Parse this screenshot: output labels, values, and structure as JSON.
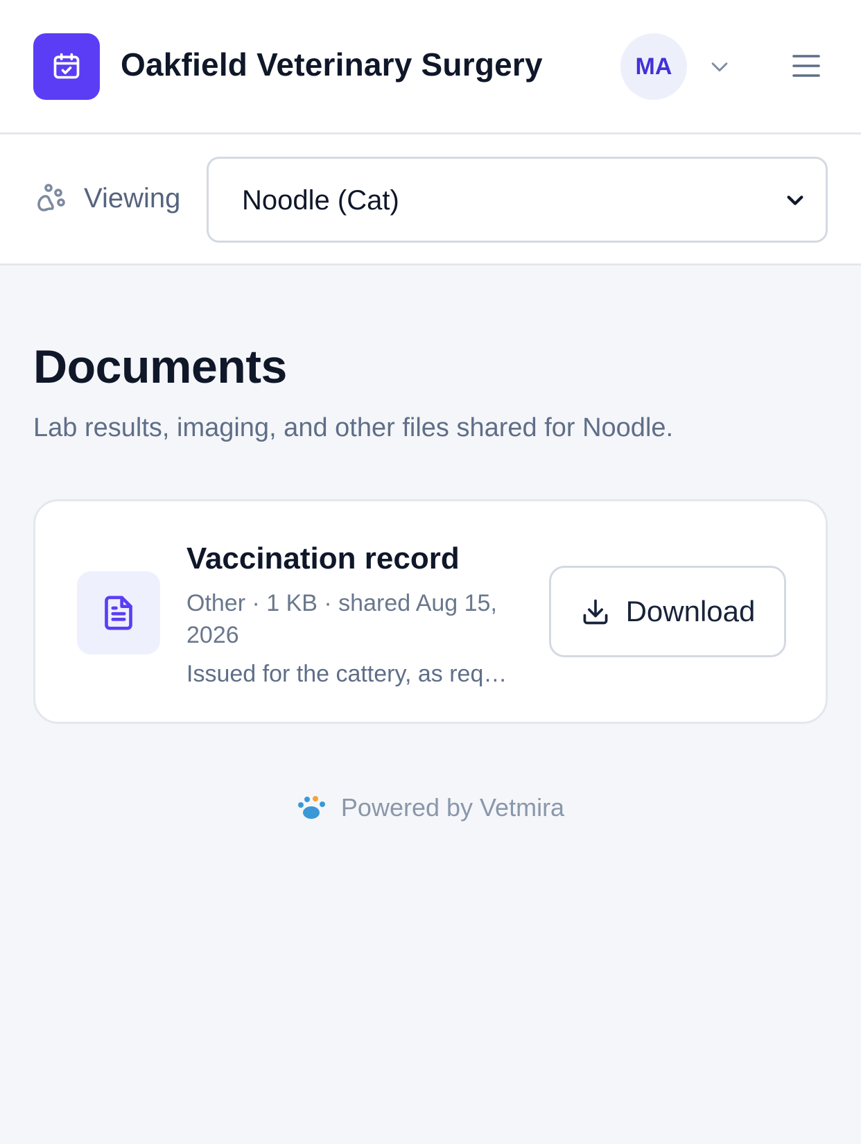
{
  "header": {
    "title": "Oakfield Veterinary Surgery",
    "logo_icon": "calendar-check-icon",
    "avatar_initials": "MA",
    "brand_color": "#5b3df5"
  },
  "selector": {
    "label": "Viewing",
    "icon": "paw-icon",
    "selected_pet": "Noodle (Cat)"
  },
  "main": {
    "title": "Documents",
    "subtitle": "Lab results, imaging, and other files shared for Noodle.",
    "documents": [
      {
        "name": "Vaccination record",
        "icon": "document-icon",
        "meta": "Other · 1 KB · shared Aug 15, 2026",
        "description": "Issued for the cattery, as requested",
        "action_label": "Download"
      }
    ]
  },
  "footer": {
    "text": "Powered by Vetmira",
    "icon": "vetmira-paw-icon"
  }
}
